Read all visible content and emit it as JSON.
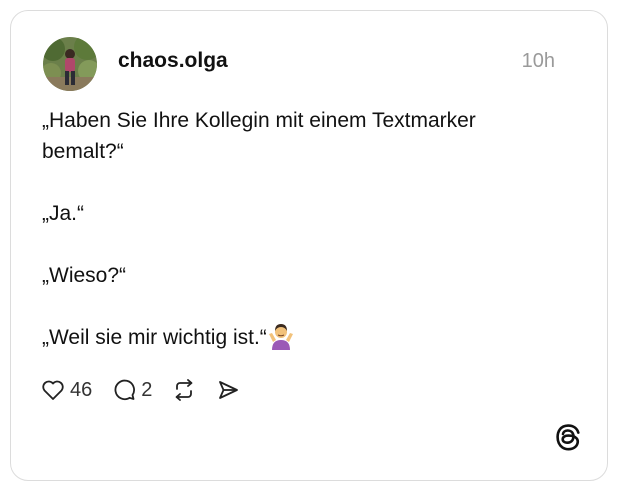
{
  "post": {
    "username": "chaos.olga",
    "timestamp": "10h",
    "lines": [
      "„Haben Sie Ihre Kollegin mit einem Textmarker",
      "bemalt?“",
      "„Ja.“",
      "„Wieso?“",
      "„Weil sie mir wichtig ist.“"
    ],
    "emoji": "person-shrugging-emoji"
  },
  "actions": {
    "like_icon": "heart-icon",
    "like_count": "46",
    "reply_icon": "comment-icon",
    "reply_count": "2",
    "repost_icon": "repost-icon",
    "share_icon": "send-icon"
  },
  "brand": {
    "logo": "threads-logo-icon"
  }
}
